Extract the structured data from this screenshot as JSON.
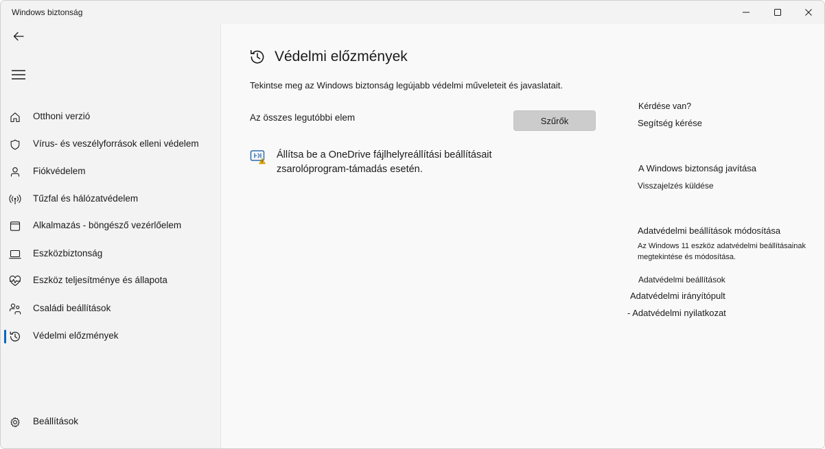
{
  "window": {
    "title": "Windows biztonság"
  },
  "sidebar": {
    "items": [
      {
        "label": "Otthoni verzió",
        "icon": "home-icon"
      },
      {
        "label": "Vírus- és veszélyforrások elleni védelem",
        "icon": "shield-icon"
      },
      {
        "label": "Fiókvédelem",
        "icon": "person-icon"
      },
      {
        "label": "Tűzfal és hálózatvédelem",
        "icon": "antenna-icon"
      },
      {
        "label": "Alkalmazás - böngésző vezérlőelem",
        "icon": "app-window-icon"
      },
      {
        "label": "Eszközbiztonság",
        "icon": "laptop-icon"
      },
      {
        "label": "Eszköz teljesítménye és állapota",
        "icon": "heart-pulse-icon"
      },
      {
        "label": "Családi beállítások",
        "icon": "family-icon"
      },
      {
        "label": "Védelmi előzmények",
        "icon": "history-icon",
        "active": true
      }
    ],
    "settings": {
      "label": "Beállítások",
      "icon": "gear-icon"
    }
  },
  "main": {
    "title": "Védelmi előzmények",
    "description": "Tekintse meg az Windows biztonság legújabb védelmi műveleteit és javaslatait.",
    "list_heading": "Az összes legutóbbi elem",
    "filter_button": "Szűrők",
    "recommendation": {
      "line1": "Állítsa be a OneDrive fájlhelyreállítási beállításait",
      "line2": "zsarolóprogram-támadás esetén.",
      "icon": "onedrive-warning-icon"
    }
  },
  "right": {
    "question": "Kérdése van?",
    "help_link": "Segítség kérése",
    "improve_heading": "A Windows biztonság javítása",
    "feedback_link": "Visszajelzés küldése",
    "privacy_heading": "Adatvédelmi beállítások módosítása",
    "privacy_desc": "Az Windows 11 eszköz adatvédelmi beállításainak megtekintése és módosítása.",
    "privacy_settings_link": "Adatvédelmi beállítások",
    "privacy_dashboard_link": "Adatvédelmi irányítópult",
    "privacy_statement_link": "- Adatvédelmi nyilatkozat"
  }
}
